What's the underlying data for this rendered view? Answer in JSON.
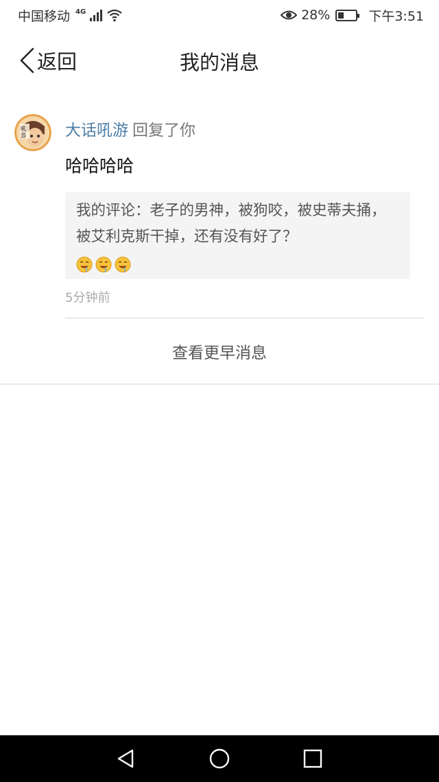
{
  "status_bar": {
    "carrier": "中国移动",
    "network": "4G",
    "battery": "28%",
    "battery_level": 0.28,
    "time": "下午3:51"
  },
  "nav": {
    "back_label": "返回",
    "title": "我的消息"
  },
  "messages": [
    {
      "sender": "大话吼游",
      "action": "回复了你",
      "body": "哈哈哈哈",
      "quote_text": "我的评论：老子的男神，被狗咬，被史蒂夫捅，被艾利克斯干掉，还有没有好了？",
      "emoji_icons": [
        "drooling-emoji-icon",
        "drooling-emoji-icon",
        "drooling-emoji-icon"
      ],
      "timestamp": "5分钟前"
    }
  ],
  "more_button": "查看更早消息",
  "colors": {
    "sender": "#4e7ea6",
    "quote_bg": "#f4f4f4",
    "divider": "#e9e9e9",
    "system_nav_bg": "#000000"
  },
  "system_nav": {
    "icons": [
      "back-triangle-icon",
      "home-circle-icon",
      "recents-square-icon"
    ]
  }
}
